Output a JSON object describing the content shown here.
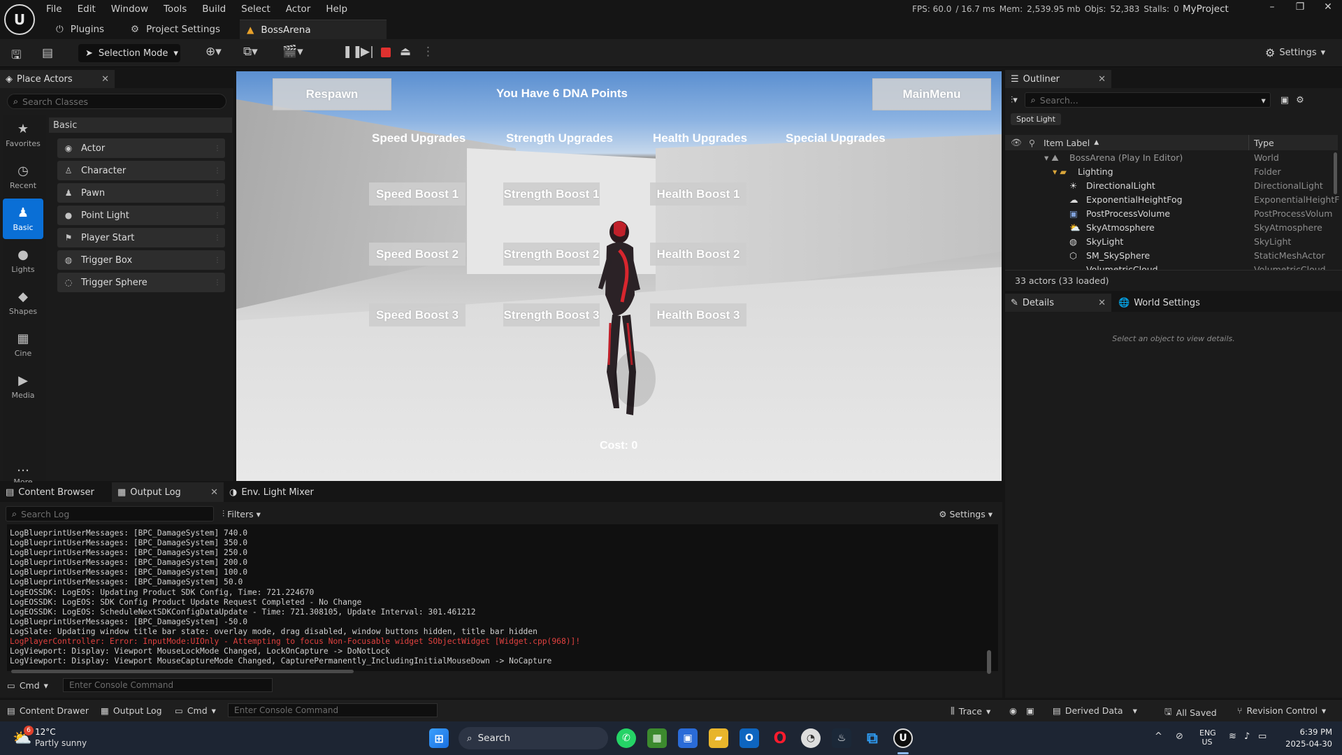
{
  "menu": [
    "File",
    "Edit",
    "Window",
    "Tools",
    "Build",
    "Select",
    "Actor",
    "Help"
  ],
  "tabs": [
    {
      "label": "Plugins",
      "icon": "plug-icon"
    },
    {
      "label": "Project Settings",
      "icon": "gear-icon"
    },
    {
      "label": "BossArena",
      "icon": "level-icon"
    }
  ],
  "stats": {
    "fps": "FPS: 60.0",
    "ms": "/ 16.7 ms",
    "mem_label": "Mem:",
    "mem": "2,539.95 mb",
    "objs_label": "Objs:",
    "objs": "52,383",
    "stalls_label": "Stalls:",
    "stalls": "0"
  },
  "project": "MyProject",
  "toolbar": {
    "selection_mode": "Selection Mode",
    "settings": "Settings"
  },
  "place_actors": {
    "title": "Place Actors",
    "search_placeholder": "Search Classes",
    "categories": [
      "Favorites",
      "Recent",
      "Basic",
      "Lights",
      "Shapes",
      "Cine",
      "Media",
      "More"
    ],
    "group": "Basic",
    "items": [
      "Actor",
      "Character",
      "Pawn",
      "Point Light",
      "Player Start",
      "Trigger Box",
      "Trigger Sphere"
    ]
  },
  "game_ui": {
    "respawn": "Respawn",
    "main_menu": "MainMenu",
    "dna": "You Have 6 DNA Points",
    "cols": [
      "Speed Upgrades",
      "Strength Upgrades",
      "Health Upgrades",
      "Special Upgrades"
    ],
    "speed": [
      "Speed Boost 1",
      "Speed Boost 2",
      "Speed Boost 3"
    ],
    "strength": [
      "Strength Boost 1",
      "Strength Boost 2",
      "Strength Boost 3"
    ],
    "health": [
      "Health Boost 1",
      "Health Boost 2",
      "Health Boost 3"
    ],
    "cost": "Cost: 0"
  },
  "outliner": {
    "title": "Outliner",
    "search_placeholder": "Search...",
    "filter_chip": "Spot Light",
    "col_label": "Item Label",
    "col_type": "Type",
    "rows": [
      {
        "label": "BossArena (Play In Editor)",
        "type": "World"
      },
      {
        "label": "Lighting",
        "type": "Folder"
      },
      {
        "label": "DirectionalLight",
        "type": "DirectionalLight"
      },
      {
        "label": "ExponentialHeightFog",
        "type": "ExponentialHeightF"
      },
      {
        "label": "PostProcessVolume",
        "type": "PostProcessVolum"
      },
      {
        "label": "SkyAtmosphere",
        "type": "SkyAtmosphere"
      },
      {
        "label": "SkyLight",
        "type": "SkyLight"
      },
      {
        "label": "SM_SkySphere",
        "type": "StaticMeshActor"
      },
      {
        "label": "VolumetricCloud",
        "type": "VolumetricCloud"
      }
    ],
    "count": "33 actors (33 loaded)"
  },
  "details": {
    "tab": "Details",
    "world_tab": "World Settings",
    "empty": "Select an object to view details."
  },
  "bottom": {
    "tabs": [
      "Content Browser",
      "Output Log",
      "Env. Light Mixer"
    ],
    "search_placeholder": "Search Log",
    "filters": "Filters",
    "settings": "Settings",
    "cmd": "Cmd",
    "console_placeholder": "Enter Console Command",
    "log": [
      {
        "text": "LogBlueprintUserMessages: [BPC_DamageSystem] 740.0",
        "err": false
      },
      {
        "text": "LogBlueprintUserMessages: [BPC_DamageSystem] 350.0",
        "err": false
      },
      {
        "text": "LogBlueprintUserMessages: [BPC_DamageSystem] 250.0",
        "err": false
      },
      {
        "text": "LogBlueprintUserMessages: [BPC_DamageSystem] 200.0",
        "err": false
      },
      {
        "text": "LogBlueprintUserMessages: [BPC_DamageSystem] 100.0",
        "err": false
      },
      {
        "text": "LogBlueprintUserMessages: [BPC_DamageSystem] 50.0",
        "err": false
      },
      {
        "text": "LogEOSSDK: LogEOS: Updating Product SDK Config, Time: 721.224670",
        "err": false
      },
      {
        "text": "LogEOSSDK: LogEOS: SDK Config Product Update Request Completed - No Change",
        "err": false
      },
      {
        "text": "LogEOSSDK: LogEOS: ScheduleNextSDKConfigDataUpdate - Time: 721.308105, Update Interval: 301.461212",
        "err": false
      },
      {
        "text": "LogBlueprintUserMessages: [BPC_DamageSystem] -50.0",
        "err": false
      },
      {
        "text": "LogSlate: Updating window title bar state: overlay mode, drag disabled, window buttons hidden, title bar hidden",
        "err": false
      },
      {
        "text": "LogPlayerController: Error: InputMode:UIOnly - Attempting to focus Non-Focusable widget SObjectWidget [Widget.cpp(968)]!",
        "err": true
      },
      {
        "text": "LogViewport: Display: Viewport MouseLockMode Changed, LockOnCapture -> DoNotLock",
        "err": false
      },
      {
        "text": "LogViewport: Display: Viewport MouseCaptureMode Changed, CapturePermanently_IncludingInitialMouseDown -> NoCapture",
        "err": false
      }
    ]
  },
  "status": {
    "content_drawer": "Content Drawer",
    "output_log": "Output Log",
    "cmd": "Cmd",
    "console_placeholder": "Enter Console Command",
    "trace": "Trace",
    "derived": "Derived Data",
    "saved": "All Saved",
    "revision": "Revision Control"
  },
  "taskbar": {
    "weather_temp": "12°C",
    "weather_desc": "Partly sunny",
    "weather_badge": "6",
    "search": "Search",
    "lang1": "ENG",
    "lang2": "US",
    "time": "6:39 PM",
    "date": "2025-04-30"
  },
  "colors": {
    "accent": "#0a6fd6",
    "error": "#e0413f"
  }
}
